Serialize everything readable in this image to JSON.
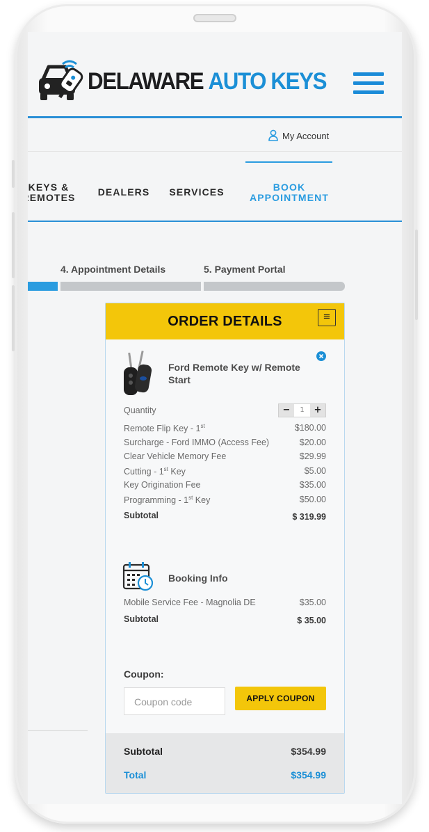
{
  "brand": {
    "word1": "DELAWARE",
    "word2": "AUTO KEYS"
  },
  "account": {
    "label": "My Account"
  },
  "nav": {
    "items": [
      {
        "line1": "KEYS &",
        "line2": "REMOTES"
      },
      {
        "line1": "DEALERS"
      },
      {
        "line1": "SERVICES"
      },
      {
        "line1": "BOOK",
        "line2": "APPOINTMENT"
      }
    ]
  },
  "steps": {
    "step4": "4. Appointment Details",
    "step5": "5. Payment Portal"
  },
  "order": {
    "title": "ORDER DETAILS",
    "menu_icon": "≡",
    "product": {
      "name": "Ford Remote Key w/ Remote Start",
      "quantity_label": "Quantity",
      "quantity": "1",
      "minus": "−",
      "plus": "+",
      "items": [
        {
          "label": "Remote Flip Key - 1",
          "sup": "st",
          "value": "$180.00"
        },
        {
          "label": "Surcharge - Ford IMMO (Access Fee)",
          "sup": "",
          "value": "$20.00"
        },
        {
          "label": "Clear Vehicle Memory Fee",
          "sup": "",
          "value": "$29.99"
        },
        {
          "label": "Cutting - 1",
          "sup": "st",
          "suffix": " Key",
          "value": "$5.00"
        },
        {
          "label": "Key Origination Fee",
          "sup": "",
          "value": "$35.00"
        },
        {
          "label": "Programming - 1",
          "sup": "st",
          "suffix": " Key",
          "value": "$50.00"
        }
      ],
      "subtotal_label": "Subtotal",
      "subtotal_value": "$ 319.99"
    },
    "booking": {
      "title": "Booking Info",
      "items": [
        {
          "label": "Mobile Service Fee - Magnolia DE",
          "value": "$35.00"
        }
      ],
      "subtotal_label": "Subtotal",
      "subtotal_value": "$ 35.00"
    },
    "coupon": {
      "label": "Coupon:",
      "placeholder": "Coupon code",
      "button": "APPLY COUPON"
    },
    "summary": {
      "subtotal_label": "Subtotal",
      "subtotal_value": "$354.99",
      "total_label": "Total",
      "total_value": "$354.99"
    }
  },
  "colors": {
    "accent_blue": "#1b8fd6",
    "accent_yellow": "#f3c60a",
    "progress_gray": "#c4c7ca",
    "progress_active": "#2a9ce0"
  },
  "progress": {
    "completed_fraction": 0.1
  }
}
